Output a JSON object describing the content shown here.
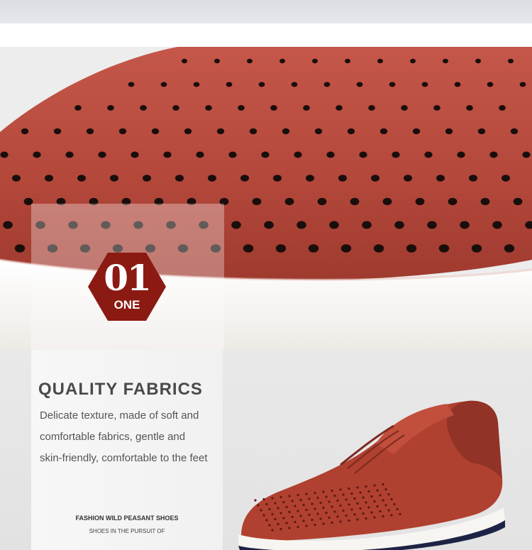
{
  "feature": {
    "number": "01",
    "number_word": "ONE",
    "heading": "QUALITY FABRICS",
    "description_lines": [
      "Delicate texture, made of soft and",
      "comfortable fabrics, gentle and",
      "skin-friendly, comfortable to the feet"
    ]
  },
  "tagline": {
    "line1": "FASHION WILD PEASANT SHOES",
    "line2": "SHOES IN THE PURSUIT OF"
  },
  "colors": {
    "leather": "#b54a3c",
    "badge": "#8b1a12",
    "heading_text": "#4a4a4a",
    "sole": "#f5f3f0"
  },
  "images": {
    "hero": "perforated-leather-closeup",
    "product": "brown-perforated-leather-sneaker"
  }
}
